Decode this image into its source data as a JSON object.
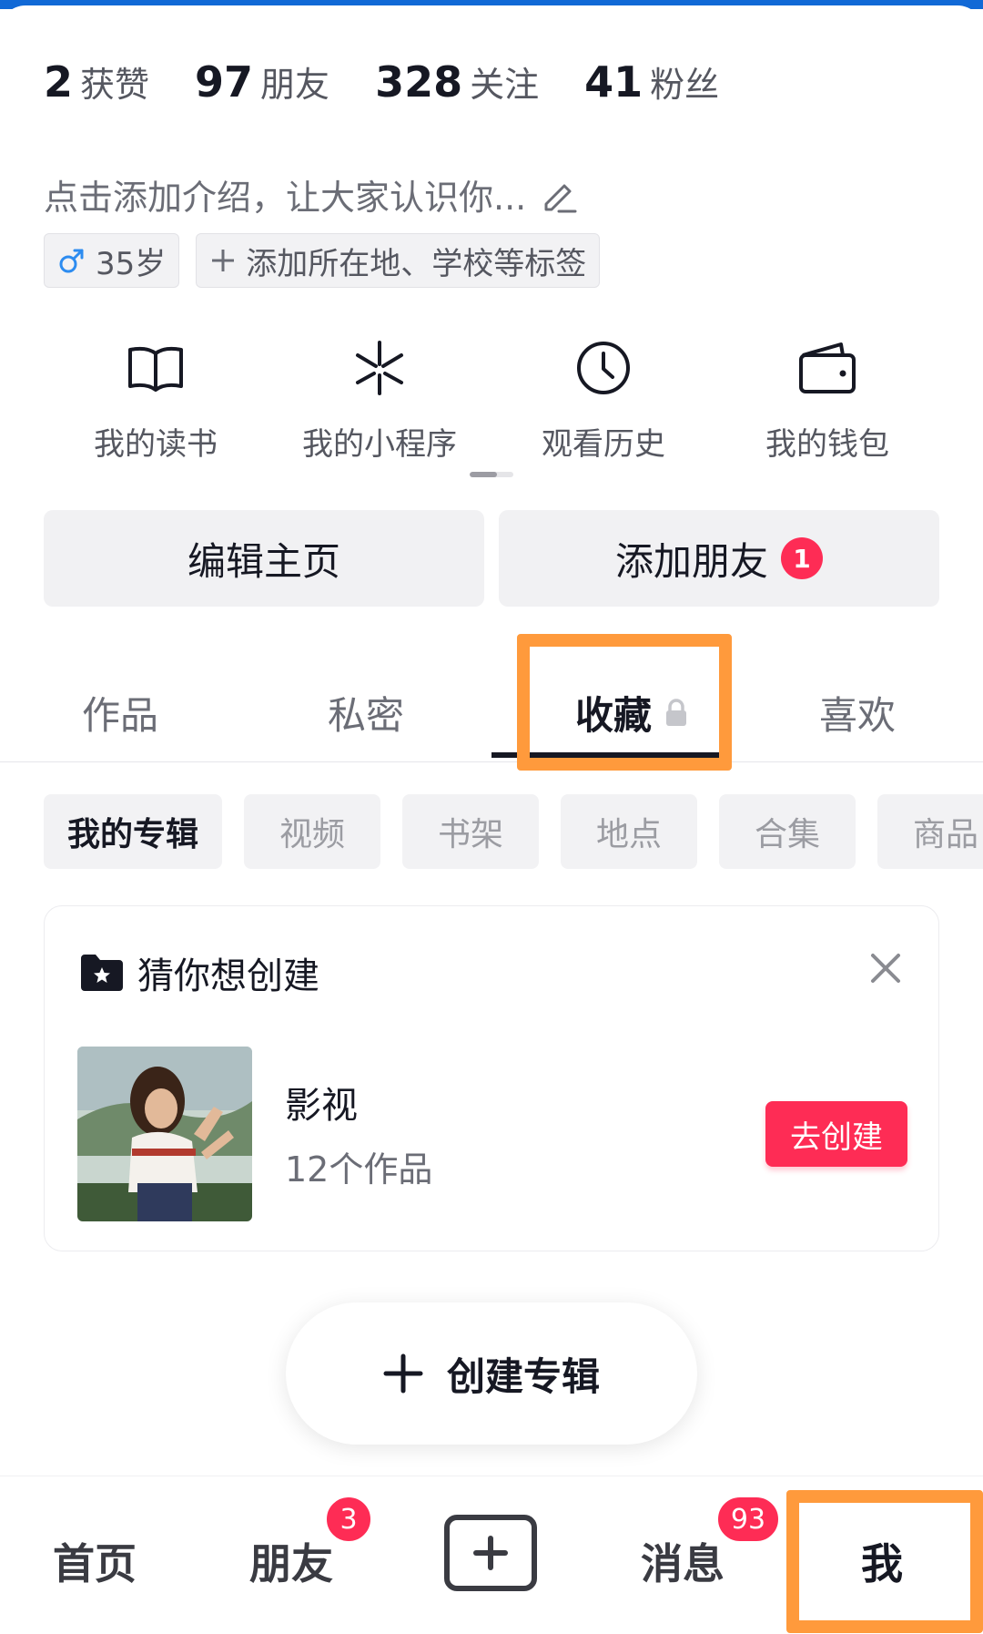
{
  "stats": [
    {
      "num": "2",
      "label": "获赞"
    },
    {
      "num": "97",
      "label": "朋友"
    },
    {
      "num": "328",
      "label": "关注"
    },
    {
      "num": "41",
      "label": "粉丝"
    }
  ],
  "bio": {
    "placeholder": "点击添加介绍，让大家认识你..."
  },
  "tags": {
    "gender_age": "35岁",
    "add_location": "添加所在地、学校等标签"
  },
  "tools": [
    {
      "icon": "book-icon",
      "label": "我的读书"
    },
    {
      "icon": "mini-program-icon",
      "label": "我的小程序"
    },
    {
      "icon": "clock-icon",
      "label": "观看历史"
    },
    {
      "icon": "wallet-icon",
      "label": "我的钱包"
    }
  ],
  "actions": {
    "edit": "编辑主页",
    "add_friend": "添加朋友",
    "add_friend_badge": "1"
  },
  "tabs": [
    {
      "label": "作品"
    },
    {
      "label": "私密"
    },
    {
      "label": "收藏",
      "active": true
    },
    {
      "label": "喜欢"
    }
  ],
  "chips": [
    "我的专辑",
    "视频",
    "书架",
    "地点",
    "合集",
    "商品"
  ],
  "suggestion": {
    "title": "猜你想创建",
    "album_title": "影视",
    "album_count": "12个作品",
    "create_button": "去创建"
  },
  "create_album": "创建专辑",
  "nav": {
    "home": "首页",
    "friends": "朋友",
    "friends_badge": "3",
    "messages": "消息",
    "messages_badge": "93",
    "me": "我"
  },
  "colors": {
    "accent": "#fe2c55",
    "highlight": "#ff9a3c",
    "topbar": "#1169d6"
  }
}
